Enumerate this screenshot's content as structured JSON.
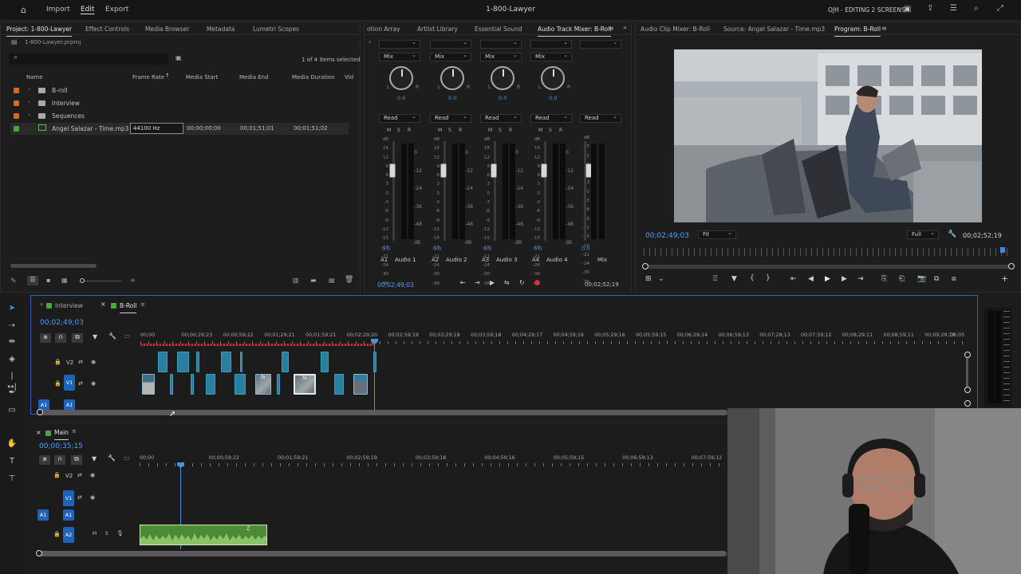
{
  "menu": {
    "home_icon": "home-icon",
    "import": "Import",
    "edit": "Edit",
    "export": "Export",
    "title": "1-800-Lawyer",
    "workspace": "OJH - EDITING 2 SCREENS"
  },
  "project": {
    "tabs": [
      "Project: 1-800-Lawyer",
      "Effect Controls",
      "Media Browser",
      "Metadata",
      "Lumetri Scopes"
    ],
    "file": "1-800-Lawyer.prproj",
    "items_selected": "1 of 4 items selected",
    "columns": [
      "Name",
      "Frame Rate",
      "Media Start",
      "Media End",
      "Media Duration",
      "Vid"
    ],
    "rows": [
      {
        "name": "B-roll",
        "color": "#d9671f",
        "frame_rate": "",
        "media_start": "",
        "media_end": "",
        "media_duration": ""
      },
      {
        "name": "Interview",
        "color": "#d9671f",
        "frame_rate": "",
        "media_start": "",
        "media_end": "",
        "media_duration": ""
      },
      {
        "name": "Sequences",
        "color": "#d9671f",
        "frame_rate": "",
        "media_start": "",
        "media_end": "",
        "media_duration": ""
      },
      {
        "name": "Angel Salazar - Time.mp3",
        "color": "#4aa83a",
        "frame_rate": "44100 Hz",
        "media_start": "00;00;00;00",
        "media_end": "00;01;51;01",
        "media_duration": "00;01;51;02"
      }
    ]
  },
  "mixer": {
    "tabs": [
      "otion Array",
      "Artlist Library",
      "Essential Sound",
      "Audio Track Mixer: B-Roll"
    ],
    "mix_label": "Mix",
    "read_label": "Read",
    "knob_value": "0.0",
    "scale": [
      "dB",
      "15",
      "12",
      "9",
      "6",
      "3",
      "0",
      "-3",
      "-6",
      "-9",
      "-12",
      "-15",
      "-18",
      "-21",
      "-24",
      "-30",
      "-36"
    ],
    "meter_scale": [
      "0",
      "-12",
      "-24",
      "-36",
      "-48",
      "dB"
    ],
    "msr": [
      "M",
      "S",
      "R"
    ],
    "fader_value": "0.0",
    "channels": [
      {
        "id": "A1",
        "name": "Audio 1"
      },
      {
        "id": "A2",
        "name": "Audio 2"
      },
      {
        "id": "A3",
        "name": "Audio 3"
      },
      {
        "id": "A4",
        "name": "Audio 4"
      },
      {
        "id": "",
        "name": "Mix"
      }
    ],
    "timecode_left": "00;02;49;03",
    "timecode_right": "00;02;52;19"
  },
  "program": {
    "tabs": [
      "Audio Clip Mixer: B-Roll",
      "Source: Angel Salazar - Time.mp3",
      "Program: B-Roll"
    ],
    "timecode": "00;02;49;03",
    "fit": "Fit",
    "quality": "Full",
    "duration": "00;02;52;19",
    "playhead_fraction": 0.98
  },
  "timeline1": {
    "tabs": [
      "Interview",
      "B-Roll"
    ],
    "timecode": "00;02;49;03",
    "ruler": [
      "00;00",
      "00;00;29;23",
      "00;00;59;22",
      "00;01;29;21",
      "00;01;59;21",
      "00;02;29;20",
      "00;02;59;19",
      "00;03;29;18",
      "00;03;59;18",
      "00;04;29;17",
      "00;04;59;16",
      "00;05;29;16",
      "00;05;59;15",
      "00;06;29;14",
      "00;06;59;13",
      "00;07;29;13",
      "00;07;59;12",
      "00;08;29;11",
      "00;08;59;11",
      "00;09;29;10",
      "00;05"
    ],
    "tracks": [
      "V2",
      "V1",
      "A1"
    ],
    "fx_label": "fx"
  },
  "timeline2": {
    "tab": "Main",
    "timecode": "00;00;35;15",
    "ruler": [
      "00;00",
      "00;00;59;22",
      "00;01;59;21",
      "00;02;59;19",
      "00;03;59;18",
      "00;04;59;16",
      "00;05;59;15",
      "00;06;59;13",
      "00;07;59;12"
    ],
    "tracks": [
      "V2",
      "V1",
      "A1",
      "A2"
    ]
  }
}
